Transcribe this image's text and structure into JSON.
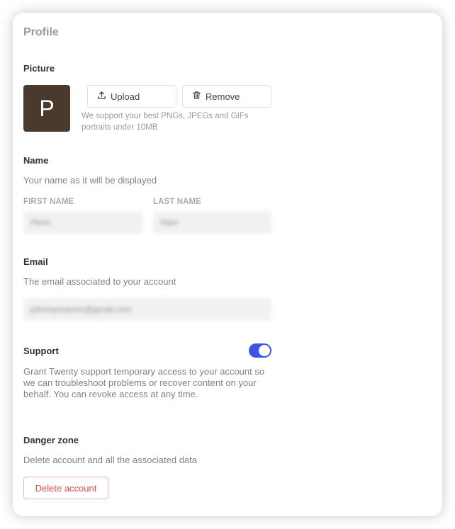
{
  "page": {
    "title": "Profile"
  },
  "picture": {
    "title": "Picture",
    "avatar_letter": "P",
    "avatar_color": "#4a3a2e",
    "upload_label": "Upload",
    "upload_icon": "upload-icon",
    "remove_label": "Remove",
    "remove_icon": "trash-icon",
    "hint": "We support your best PNGs, JPEGs and GIFs portraits under 10MB"
  },
  "name": {
    "title": "Name",
    "description": "Your name as it will be displayed",
    "first_name_label": "FIRST NAME",
    "first_name_value": "Henri",
    "last_name_label": "LAST NAME",
    "last_name_value": "Ham"
  },
  "email": {
    "title": "Email",
    "description": "The email associated to your account",
    "value": "johnhasnamer@gmail.com"
  },
  "support": {
    "title": "Support",
    "enabled": true,
    "accent_color": "#3e53e6",
    "description": "Grant Twenty support temporary access to your account so we can troubleshoot problems or recover content on your behalf. You can revoke access at any time."
  },
  "danger_zone": {
    "title": "Danger zone",
    "description": "Delete account and all the associated data",
    "delete_label": "Delete account",
    "danger_color": "#e04b4b"
  }
}
